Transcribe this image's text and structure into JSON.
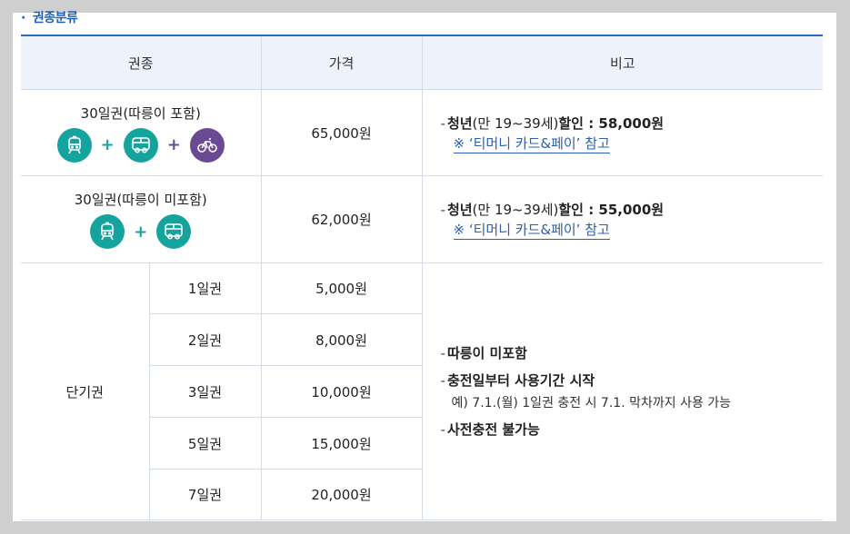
{
  "section": {
    "title": "권종분류"
  },
  "table": {
    "headers": [
      "권종",
      "가격",
      "비고"
    ],
    "monthly_incl": {
      "name": "30일권(따릉이 포함)",
      "price": "65,000원",
      "discount_prefix": "청년",
      "discount_age": "(만 19~39세)",
      "discount_suffix": "할인 : 58,000원",
      "link": "※ ‘티머니 카드&페이’ 참고"
    },
    "monthly_excl": {
      "name": "30일권(따릉이 미포함)",
      "price": "62,000원",
      "discount_prefix": "청년",
      "discount_age": "(만 19~39세)",
      "discount_suffix": "할인 : 55,000원",
      "link": "※ ‘티머니 카드&페이’ 참고"
    },
    "short_term": {
      "name": "단기권",
      "rows": [
        {
          "label": "1일권",
          "price": "5,000원"
        },
        {
          "label": "2일권",
          "price": "8,000원"
        },
        {
          "label": "3일권",
          "price": "10,000원"
        },
        {
          "label": "5일권",
          "price": "15,000원"
        },
        {
          "label": "7일권",
          "price": "20,000원"
        }
      ],
      "notes": {
        "n1": "따릉이 미포함",
        "n2": "충전일부터 사용기간 시작",
        "example": "예) 7.1.(월) 1일권 충전 시 7.1. 막차까지 사용 가능",
        "n3": "사전충전 불가능"
      }
    }
  },
  "icons": [
    "subway-icon",
    "bus-icon",
    "bicycle-icon"
  ],
  "colors": {
    "teal": "#15a39d",
    "purple": "#6a4a92",
    "accent": "#2a68c2"
  }
}
